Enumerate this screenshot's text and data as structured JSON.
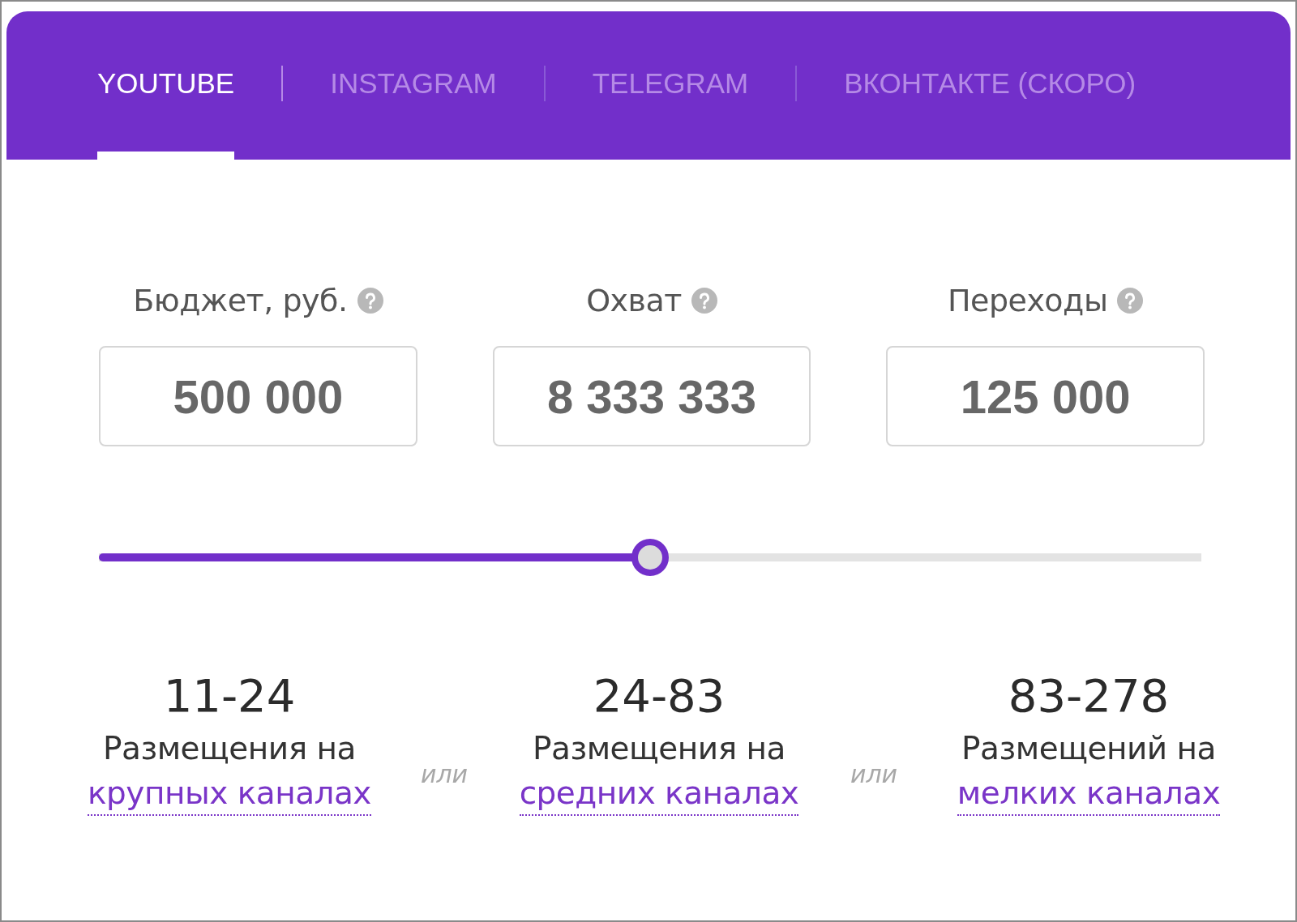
{
  "tabs": [
    {
      "label": "YOUTUBE",
      "selected": true
    },
    {
      "label": "INSTAGRAM",
      "selected": false
    },
    {
      "label": "TELEGRAM",
      "selected": false
    },
    {
      "label": "ВКОНТАКТЕ (СКОРО)",
      "selected": false
    }
  ],
  "fields": [
    {
      "label": "Бюджет, руб.",
      "value": "500 000"
    },
    {
      "label": "Охват",
      "value": "8 333 333"
    },
    {
      "label": "Переходы",
      "value": "125 000"
    }
  ],
  "slider": {
    "level": 0.5
  },
  "options": [
    {
      "count": "11-24",
      "text": "Размещения на",
      "link": "крупных каналах"
    },
    {
      "count": "24-83",
      "text": "Размещения на",
      "link": "средних каналах"
    },
    {
      "count": "83-278",
      "text": "Размещений на",
      "link": "мелких каналах"
    }
  ],
  "dividers": [
    "или",
    "или"
  ]
}
